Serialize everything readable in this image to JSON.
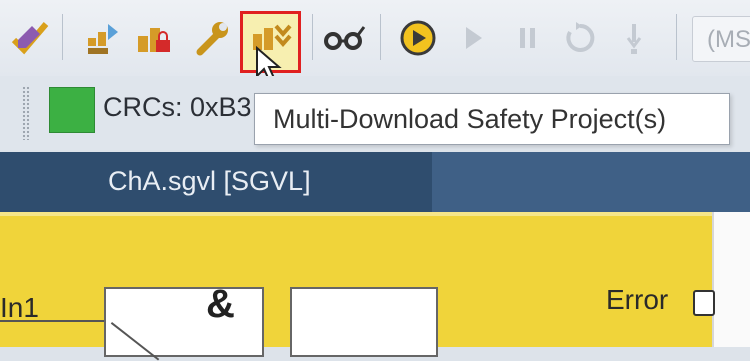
{
  "toolbar": {
    "combo_text": "(MS",
    "icons": [
      "check-edit-icon",
      "compile-icon",
      "download-lock-icon",
      "wrench-icon",
      "multi-download-icon",
      "glasses-icon",
      "run-icon",
      "play-icon",
      "pause-icon",
      "reset-icon",
      "step-icon"
    ],
    "highlight_color": "#e02020"
  },
  "status": {
    "crc_text": "CRCs: 0xB3",
    "crc_indicator_color": "#3cb043"
  },
  "tooltip": {
    "text": "Multi-Download Safety Project(s)"
  },
  "tabs": [
    {
      "label": "ChA.sgvl [SGVL]"
    }
  ],
  "diagram": {
    "input_label": "In1",
    "and_symbol": "&",
    "output_label": "Error"
  }
}
